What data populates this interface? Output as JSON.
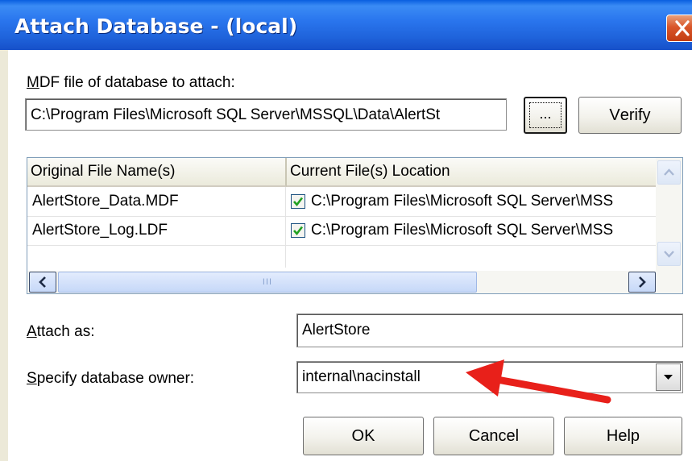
{
  "window": {
    "title": "Attach Database - (local)"
  },
  "mdf": {
    "label_underlined": "M",
    "label_rest": "DF file of database to attach:",
    "path_value": "C:\\Program Files\\Microsoft SQL Server\\MSSQL\\Data\\AlertSt",
    "browse_label": "...",
    "verify_underlined": "V",
    "verify_rest": "erify"
  },
  "file_list": {
    "columns": [
      "Original File Name(s)",
      "Current File(s) Location"
    ],
    "rows": [
      {
        "name": "AlertStore_Data.MDF",
        "checked": true,
        "location": "C:\\Program Files\\Microsoft SQL Server\\MSS"
      },
      {
        "name": "AlertStore_Log.LDF",
        "checked": true,
        "location": "C:\\Program Files\\Microsoft SQL Server\\MSS"
      }
    ],
    "scroll_grip": "III"
  },
  "attach_as": {
    "label_underlined": "A",
    "label_rest": "ttach as:",
    "value": "AlertStore"
  },
  "owner": {
    "label_underlined": "S",
    "label_rest": "pecify database owner:",
    "value": "internal\\nacinstall"
  },
  "buttons": {
    "ok": "OK",
    "cancel": "Cancel",
    "help": "Help"
  },
  "colors": {
    "titlebar": "#1f63db",
    "dialog_bg": "#ece9d8",
    "arrow": "#e8201a",
    "checkmark": "#21a121"
  }
}
